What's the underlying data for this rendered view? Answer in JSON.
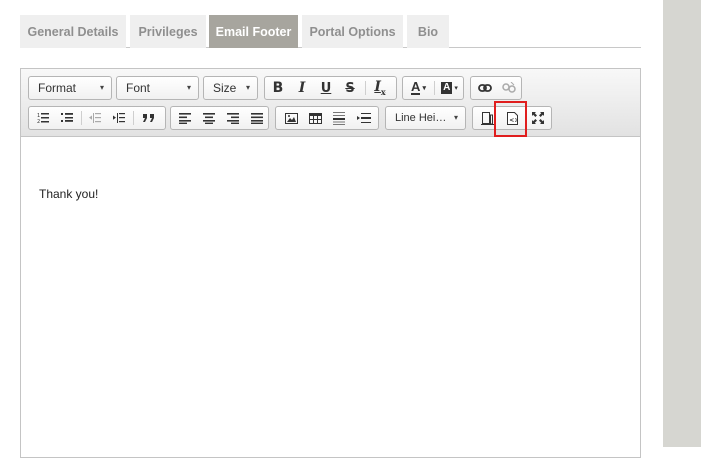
{
  "tabs": [
    {
      "label": "General Details"
    },
    {
      "label": "Privileges"
    },
    {
      "label": "Email Footer"
    },
    {
      "label": "Portal Options"
    },
    {
      "label": "Bio"
    }
  ],
  "active_tab": "Email Footer",
  "toolbar": {
    "format_label": "Format",
    "font_label": "Font",
    "size_label": "Size",
    "line_height_label": "Line Hei…",
    "caret": "▾",
    "font_color_letter": "A",
    "bg_color_letter": "A",
    "clear_format_letter": "I",
    "clear_format_sub": "x",
    "icons": [
      "bold-icon",
      "italic-icon",
      "underline-icon",
      "strikethrough-icon",
      "clear-format-icon",
      "font-color-icon",
      "background-color-icon",
      "link-icon",
      "unlink-icon",
      "numbered-list-icon",
      "bulleted-list-icon",
      "outdent-icon",
      "indent-icon",
      "blockquote-icon",
      "align-left-icon",
      "align-center-icon",
      "align-right-icon",
      "justify-icon",
      "image-icon",
      "table-icon",
      "horizontal-rule-icon",
      "page-break-icon",
      "template-icon",
      "source-code-icon",
      "fullscreen-icon"
    ],
    "highlight_color": "#e01e1e"
  },
  "editor": {
    "content": "Thank you!"
  },
  "colors": {
    "active_tab_bg": "#a7a59e",
    "inactive_tab_bg": "#efefef",
    "side_panel": "#d6d6d1"
  }
}
